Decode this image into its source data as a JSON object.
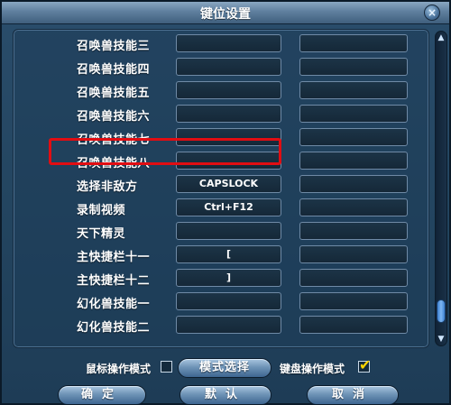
{
  "window": {
    "title": "键位设置",
    "close_label": "×"
  },
  "rows": [
    {
      "label": "召唤兽技能三",
      "key1": "",
      "key2": ""
    },
    {
      "label": "召唤兽技能四",
      "key1": "",
      "key2": ""
    },
    {
      "label": "召唤兽技能五",
      "key1": "",
      "key2": ""
    },
    {
      "label": "召唤兽技能六",
      "key1": "",
      "key2": ""
    },
    {
      "label": "召唤兽技能七",
      "key1": "",
      "key2": ""
    },
    {
      "label": "召唤兽技能八",
      "key1": "",
      "key2": ""
    },
    {
      "label": "选择非敌方",
      "key1": "CAPSLOCK",
      "key2": ""
    },
    {
      "label": "录制视频",
      "key1": "Ctrl+F12",
      "key2": ""
    },
    {
      "label": "天下精灵",
      "key1": "",
      "key2": ""
    },
    {
      "label": "主快捷栏十一",
      "key1": "[",
      "key2": ""
    },
    {
      "label": "主快捷栏十二",
      "key1": "]",
      "key2": ""
    },
    {
      "label": "幻化兽技能一",
      "key1": "",
      "key2": ""
    },
    {
      "label": "幻化兽技能二",
      "key1": "",
      "key2": ""
    }
  ],
  "mode": {
    "mouse_label": "鼠标操作模式",
    "mouse_checked": false,
    "select_button": "模式选择",
    "keyboard_label": "键盘操作模式",
    "keyboard_checked": true
  },
  "buttons": {
    "ok": "确定",
    "default": "默认",
    "cancel": "取消"
  },
  "scrollbar": {
    "up_icon": "▲",
    "down_icon": "▼",
    "position": 0.92
  },
  "colors": {
    "highlight": "#e10d12",
    "check": "#ffd400"
  }
}
